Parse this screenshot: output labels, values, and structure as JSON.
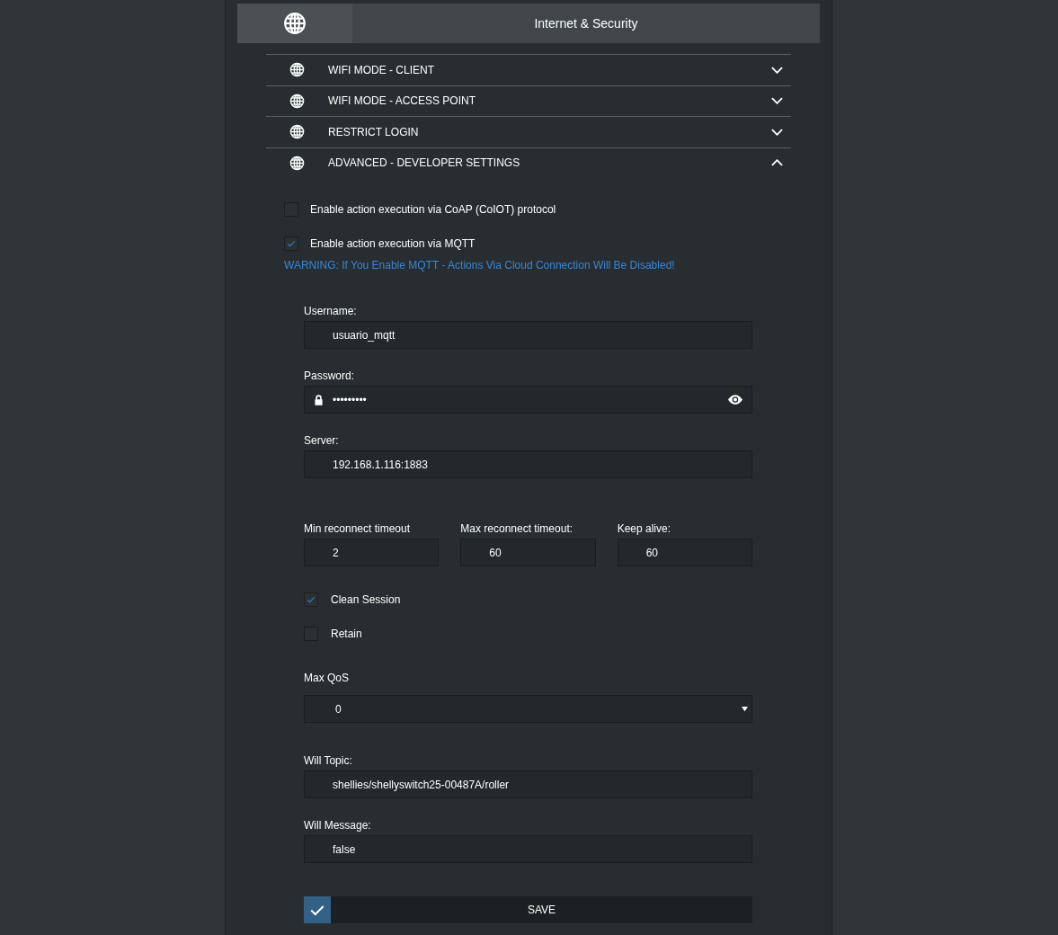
{
  "header": {
    "title": "Internet & Security"
  },
  "sections": [
    {
      "title": "WIFI MODE - CLIENT",
      "expanded": false
    },
    {
      "title": "WIFI MODE - ACCESS POINT",
      "expanded": false
    },
    {
      "title": "RESTRICT LOGIN",
      "expanded": false
    },
    {
      "title": "ADVANCED - DEVELOPER SETTINGS",
      "expanded": true
    }
  ],
  "options": [
    {
      "label": "Enable action execution via CoAP (CoIOT) protocol",
      "checked": false
    },
    {
      "label": "Enable action execution via MQTT",
      "checked": true
    }
  ],
  "warning": "WARNING: If You Enable MQTT - Actions Via Cloud Connection Will Be Disabled!",
  "fields": [
    {
      "label": "Username:",
      "value": "usuario_mqtt",
      "kind": "text"
    },
    {
      "label": "Password:",
      "value": "•••••••••",
      "kind": "password"
    },
    {
      "label": "Server:",
      "value": "192.168.1.116:1883",
      "kind": "text"
    }
  ],
  "timeouts": [
    {
      "label": "Min reconnect timeout",
      "value": "2"
    },
    {
      "label": "Max reconnect timeout:",
      "value": "60"
    },
    {
      "label": "Keep alive:",
      "value": "60"
    }
  ],
  "flags": [
    {
      "label": "Clean Session",
      "checked": true
    },
    {
      "label": "Retain",
      "checked": false
    }
  ],
  "qos": {
    "label": "Max QoS",
    "value": "0"
  },
  "will": [
    {
      "label": "Will Topic:",
      "value": "shellies/shellyswitch25-00487A/roller"
    },
    {
      "label": "Will Message:",
      "value": "false"
    }
  ],
  "save": {
    "label": "SAVE"
  }
}
